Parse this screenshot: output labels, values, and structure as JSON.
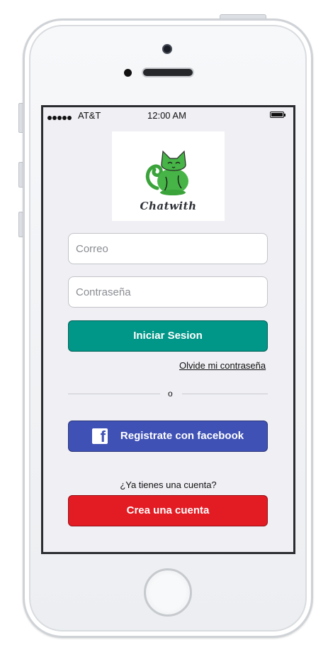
{
  "status_bar": {
    "carrier": "AT&T",
    "time": "12:00 AM"
  },
  "logo": {
    "text": "Chatwith",
    "icon": "green-cat-icon"
  },
  "form": {
    "email_placeholder": "Correo",
    "password_placeholder": "Contraseña",
    "login_label": "Iniciar Sesion",
    "forgot_label": "Olvide mi contraseña",
    "divider_text": "o",
    "facebook_label": "Registrate con facebook",
    "has_account_text": "¿Ya tienes una cuenta?",
    "create_label": "Crea una cuenta"
  },
  "colors": {
    "login": "#009688",
    "facebook": "#3f51b5",
    "create": "#e31b23",
    "screen_bg": "#efeff4"
  }
}
